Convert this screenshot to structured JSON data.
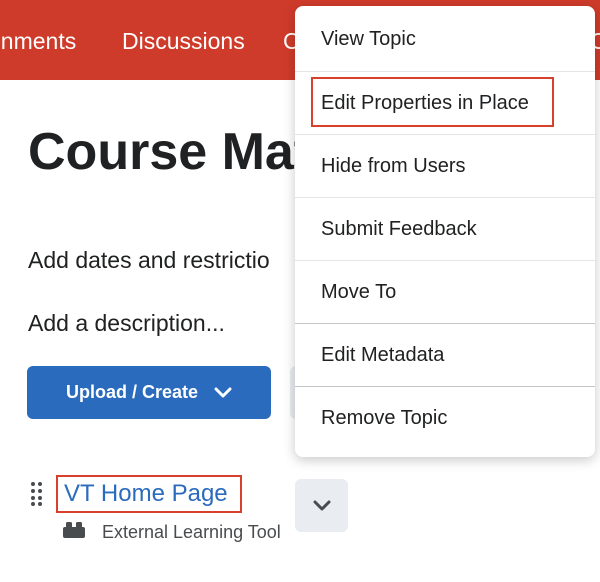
{
  "nav": {
    "items": [
      "gnments",
      "Discussions",
      "C",
      "C"
    ]
  },
  "page": {
    "title": "Course Mat",
    "dates_link": "Add dates and restrictio",
    "description_link": "Add a description..."
  },
  "toolbar": {
    "upload_label": "Upload / Create",
    "upload_icon": "chevron-down-icon"
  },
  "topic": {
    "title": "VT Home Page",
    "type_label": "External Learning Tool",
    "type_icon": "puzzle-piece-icon"
  },
  "menu": {
    "items": [
      "View Topic",
      "Edit Properties in Place",
      "Hide from Users",
      "Submit Feedback",
      "Move To",
      "Edit Metadata",
      "Remove Topic"
    ]
  },
  "colors": {
    "nav_bg": "#cf3b2a",
    "primary": "#2b6bbd",
    "highlight": "#d9402b",
    "secondary_btn": "#e9ecf1",
    "text": "#202122"
  }
}
